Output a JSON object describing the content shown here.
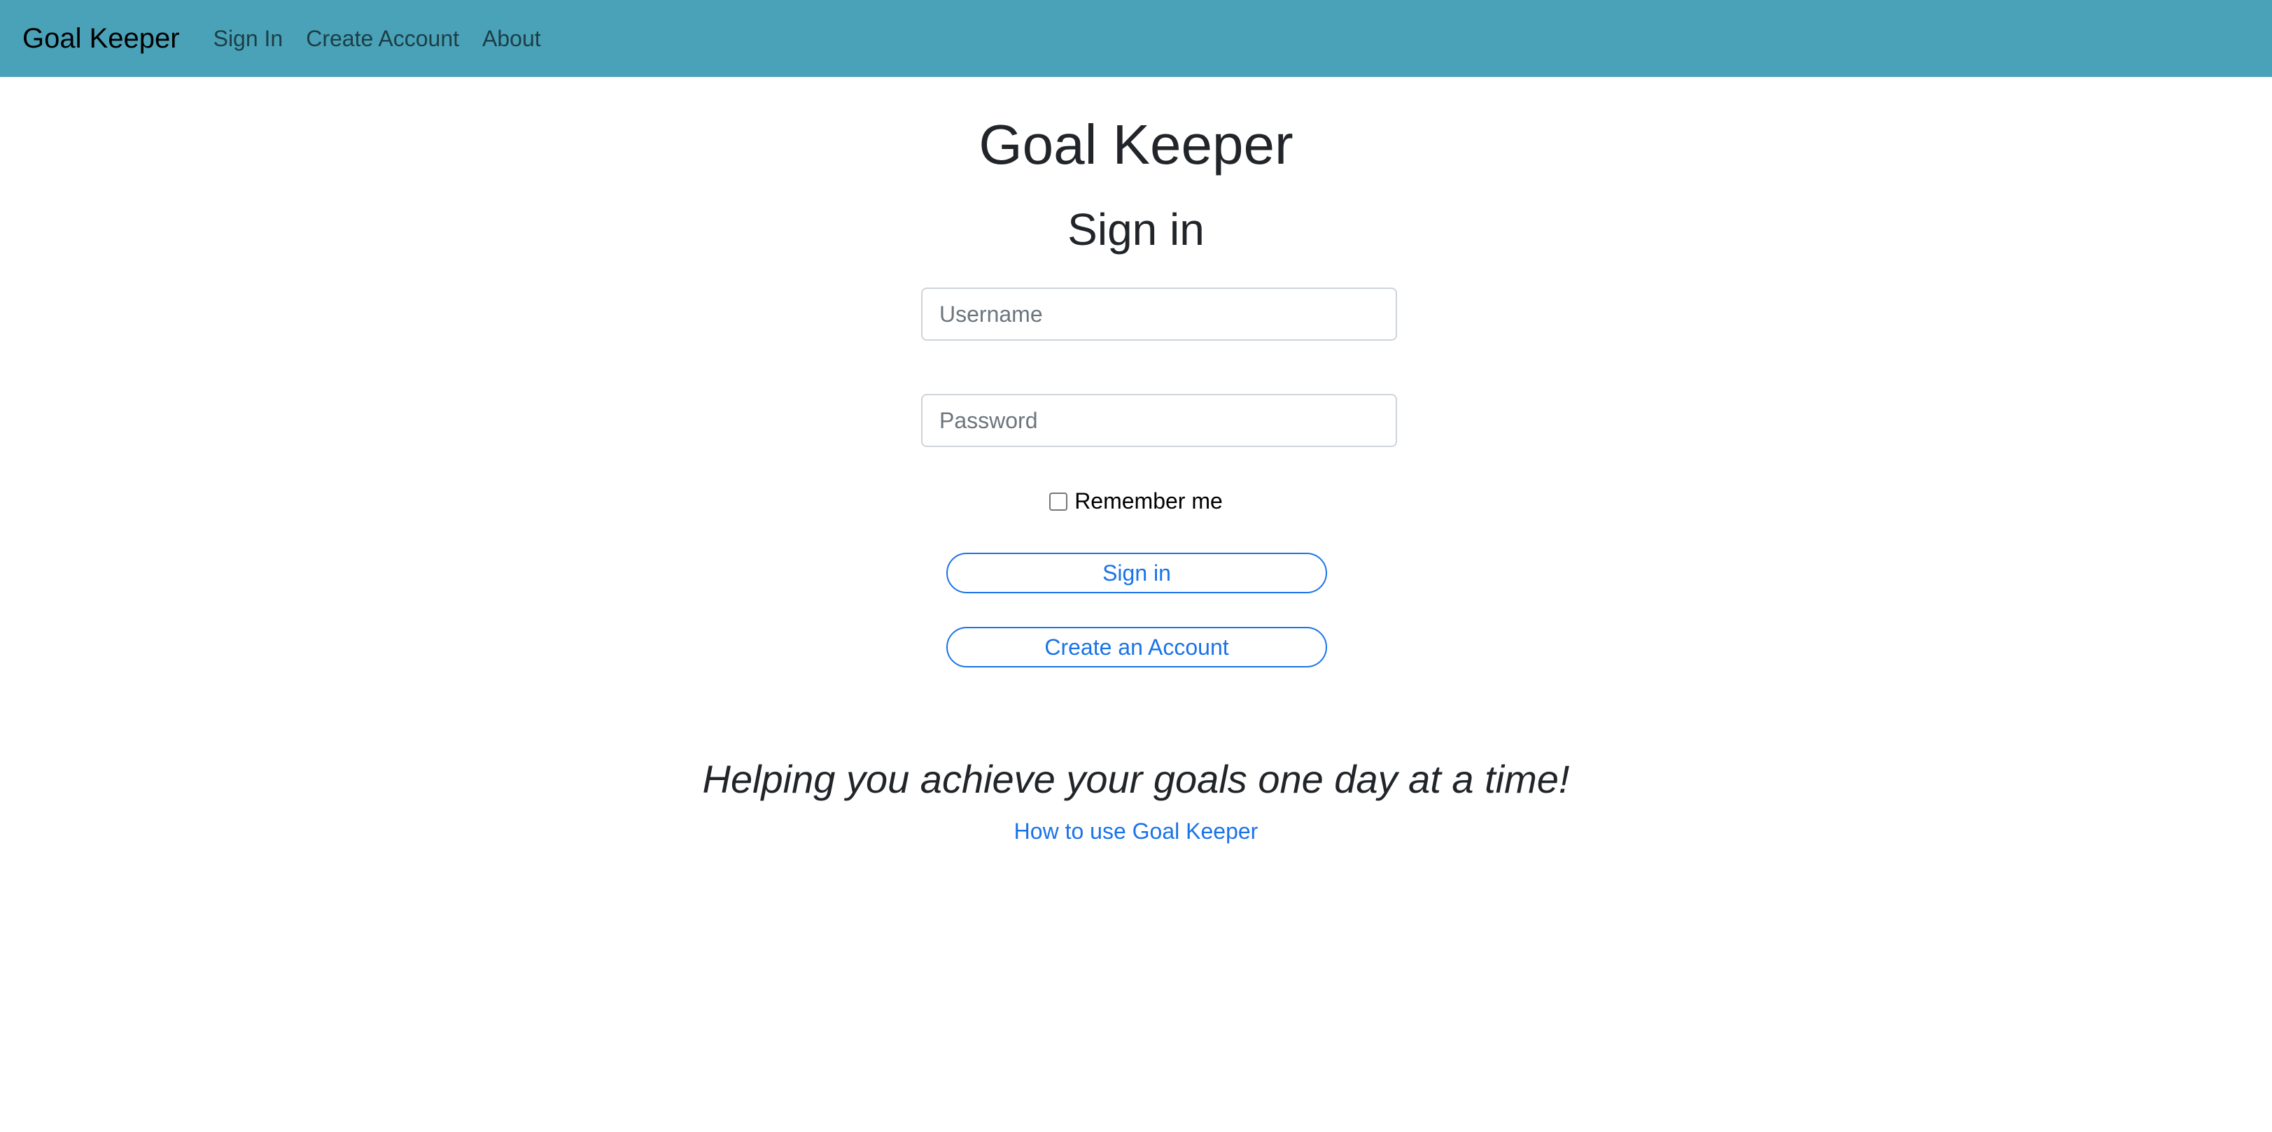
{
  "nav": {
    "brand": "Goal Keeper",
    "links": [
      "Sign In",
      "Create Account",
      "About"
    ]
  },
  "page": {
    "title": "Goal Keeper",
    "form_title": "Sign in"
  },
  "form": {
    "username_placeholder": "Username",
    "username_value": "",
    "password_placeholder": "Password",
    "password_value": "",
    "remember_label": "Remember me",
    "remember_checked": false,
    "signin_button": "Sign in",
    "create_button": "Create an Account"
  },
  "footer": {
    "tagline": "Helping you achieve your goals one day at a time!",
    "help_link": "How to use Goal Keeper"
  },
  "colors": {
    "navbar": "#4aa2b8",
    "accent": "#1a73e8"
  }
}
